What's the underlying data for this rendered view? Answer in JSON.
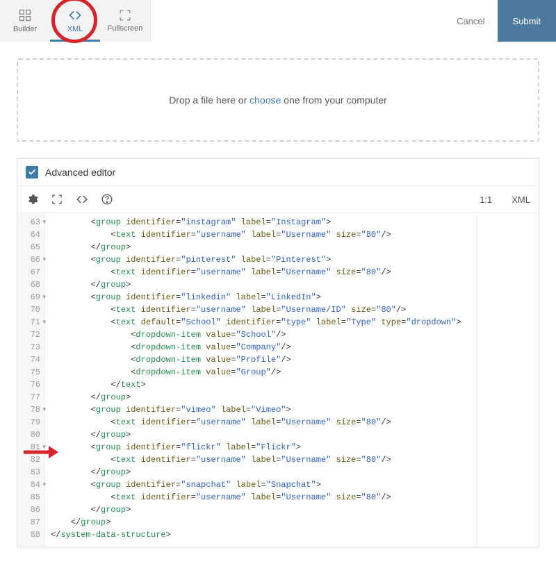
{
  "topbar": {
    "tabs": [
      {
        "name": "builder",
        "label": "Builder",
        "active": false
      },
      {
        "name": "xml",
        "label": "XML",
        "active": true
      },
      {
        "name": "fullscreen",
        "label": "Fullscreen",
        "active": false
      }
    ],
    "cancel_label": "Cancel",
    "submit_label": "Submit"
  },
  "dropzone": {
    "text_before": "Drop a file here or ",
    "choose_label": "choose",
    "text_after": " one from your computer"
  },
  "editor": {
    "advanced_checkbox_checked": true,
    "advanced_label": "Advanced editor",
    "cursor_position": "1:1",
    "mode": "XML",
    "lines": [
      {
        "num": 63,
        "fold": "▾",
        "indent": 2,
        "xml": {
          "type": "open",
          "tag": "group",
          "attrs": [
            [
              "identifier",
              "instagram"
            ],
            [
              "label",
              "Instagram"
            ]
          ]
        }
      },
      {
        "num": 64,
        "fold": "",
        "indent": 3,
        "xml": {
          "type": "self",
          "tag": "text",
          "attrs": [
            [
              "identifier",
              "username"
            ],
            [
              "label",
              "Username"
            ],
            [
              "size",
              "80"
            ]
          ]
        }
      },
      {
        "num": 65,
        "fold": "",
        "indent": 2,
        "xml": {
          "type": "close",
          "tag": "group"
        }
      },
      {
        "num": 66,
        "fold": "▾",
        "indent": 2,
        "xml": {
          "type": "open",
          "tag": "group",
          "attrs": [
            [
              "identifier",
              "pinterest"
            ],
            [
              "label",
              "Pinterest"
            ]
          ]
        }
      },
      {
        "num": 67,
        "fold": "",
        "indent": 3,
        "xml": {
          "type": "self",
          "tag": "text",
          "attrs": [
            [
              "identifier",
              "username"
            ],
            [
              "label",
              "Username"
            ],
            [
              "size",
              "80"
            ]
          ]
        }
      },
      {
        "num": 68,
        "fold": "",
        "indent": 2,
        "xml": {
          "type": "close",
          "tag": "group"
        }
      },
      {
        "num": 69,
        "fold": "▾",
        "indent": 2,
        "xml": {
          "type": "open",
          "tag": "group",
          "attrs": [
            [
              "identifier",
              "linkedin"
            ],
            [
              "label",
              "LinkedIn"
            ]
          ]
        }
      },
      {
        "num": 70,
        "fold": "",
        "indent": 3,
        "xml": {
          "type": "self",
          "tag": "text",
          "attrs": [
            [
              "identifier",
              "username"
            ],
            [
              "label",
              "Username/ID"
            ],
            [
              "size",
              "80"
            ]
          ]
        }
      },
      {
        "num": 71,
        "fold": "▾",
        "indent": 3,
        "xml": {
          "type": "open",
          "tag": "text",
          "attrs": [
            [
              "default",
              "School"
            ],
            [
              "identifier",
              "type"
            ],
            [
              "label",
              "Type"
            ],
            [
              "type",
              "dropdown"
            ]
          ]
        }
      },
      {
        "num": 72,
        "fold": "",
        "indent": 4,
        "xml": {
          "type": "self",
          "tag": "dropdown-item",
          "attrs": [
            [
              "value",
              "School"
            ]
          ]
        }
      },
      {
        "num": 73,
        "fold": "",
        "indent": 4,
        "xml": {
          "type": "self",
          "tag": "dropdown-item",
          "attrs": [
            [
              "value",
              "Company"
            ]
          ]
        }
      },
      {
        "num": 74,
        "fold": "",
        "indent": 4,
        "xml": {
          "type": "self",
          "tag": "dropdown-item",
          "attrs": [
            [
              "value",
              "Profile"
            ]
          ]
        }
      },
      {
        "num": 75,
        "fold": "",
        "indent": 4,
        "xml": {
          "type": "self",
          "tag": "dropdown-item",
          "attrs": [
            [
              "value",
              "Group"
            ]
          ]
        }
      },
      {
        "num": 76,
        "fold": "",
        "indent": 3,
        "xml": {
          "type": "close",
          "tag": "text"
        }
      },
      {
        "num": 77,
        "fold": "",
        "indent": 2,
        "xml": {
          "type": "close",
          "tag": "group"
        }
      },
      {
        "num": 78,
        "fold": "▾",
        "indent": 2,
        "xml": {
          "type": "open",
          "tag": "group",
          "attrs": [
            [
              "identifier",
              "vimeo"
            ],
            [
              "label",
              "Vimeo"
            ]
          ]
        }
      },
      {
        "num": 79,
        "fold": "",
        "indent": 3,
        "xml": {
          "type": "self",
          "tag": "text",
          "attrs": [
            [
              "identifier",
              "username"
            ],
            [
              "label",
              "Username"
            ],
            [
              "size",
              "80"
            ]
          ]
        }
      },
      {
        "num": 80,
        "fold": "",
        "indent": 2,
        "xml": {
          "type": "close",
          "tag": "group"
        }
      },
      {
        "num": 81,
        "fold": "▾",
        "indent": 2,
        "xml": {
          "type": "open",
          "tag": "group",
          "attrs": [
            [
              "identifier",
              "flickr"
            ],
            [
              "label",
              "Flickr"
            ]
          ]
        }
      },
      {
        "num": 82,
        "fold": "",
        "indent": 3,
        "xml": {
          "type": "self",
          "tag": "text",
          "attrs": [
            [
              "identifier",
              "username"
            ],
            [
              "label",
              "Username"
            ],
            [
              "size",
              "80"
            ]
          ]
        }
      },
      {
        "num": 83,
        "fold": "",
        "indent": 2,
        "xml": {
          "type": "close",
          "tag": "group"
        }
      },
      {
        "num": 84,
        "fold": "▾",
        "indent": 2,
        "xml": {
          "type": "open",
          "tag": "group",
          "attrs": [
            [
              "identifier",
              "snapchat"
            ],
            [
              "label",
              "Snapchat"
            ]
          ]
        }
      },
      {
        "num": 85,
        "fold": "",
        "indent": 3,
        "xml": {
          "type": "self",
          "tag": "text",
          "attrs": [
            [
              "identifier",
              "username"
            ],
            [
              "label",
              "Username"
            ],
            [
              "size",
              "80"
            ]
          ]
        }
      },
      {
        "num": 86,
        "fold": "",
        "indent": 2,
        "xml": {
          "type": "close",
          "tag": "group"
        }
      },
      {
        "num": 87,
        "fold": "",
        "indent": 1,
        "xml": {
          "type": "close",
          "tag": "group"
        }
      },
      {
        "num": 88,
        "fold": "",
        "indent": 0,
        "xml": {
          "type": "close",
          "tag": "system-data-structure"
        }
      }
    ]
  }
}
